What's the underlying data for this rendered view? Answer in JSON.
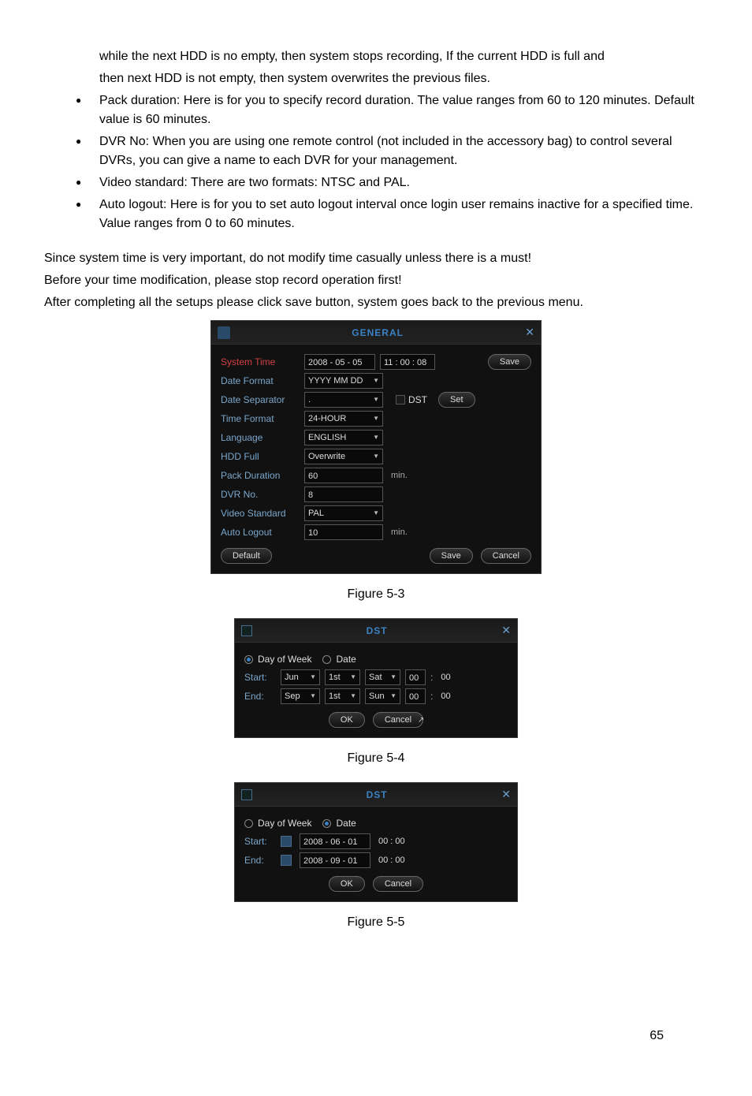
{
  "intro_lines": [
    "while the next HDD is no empty, then system stops recording, If the current HDD is full and",
    "then next HDD is not empty, then system overwrites the previous files."
  ],
  "bullets": [
    "Pack duration: Here is for you to specify record duration. The value ranges from 60 to 120 minutes. Default value is 60 minutes.",
    "DVR No: When you are using one remote control (not included in the accessory bag) to control several DVRs, you can give a name to each DVR for your management.",
    "Video standard: There are two formats: NTSC and PAL.",
    "Auto logout: Here is for you to set auto logout interval once login user remains inactive for a specified time. Value ranges from 0 to 60 minutes."
  ],
  "para1": "Since system time is very important, do not modify time casually unless there is a must!",
  "para2": "Before your time modification, please stop record operation first!",
  "para3": "After completing all the setups please click save button, system goes back to the previous menu.",
  "figure_5_3": "Figure 5-3",
  "figure_5_4": "Figure 5-4",
  "figure_5_5": "Figure 5-5",
  "page_num": "65",
  "general": {
    "title": "GENERAL",
    "system_time_label": "System Time",
    "system_date": "2008 - 05 - 05",
    "system_time": "11 : 00 : 08",
    "save_btn": "Save",
    "date_format_label": "Date Format",
    "date_format": "YYYY MM DD",
    "date_separator_label": "Date Separator",
    "date_separator": ".",
    "dst_label": "DST",
    "set_btn": "Set",
    "time_format_label": "Time Format",
    "time_format": "24-HOUR",
    "language_label": "Language",
    "language": "ENGLISH",
    "hdd_full_label": "HDD Full",
    "hdd_full": "Overwrite",
    "pack_duration_label": "Pack Duration",
    "pack_duration": "60",
    "min_unit": "min.",
    "dvr_no_label": "DVR No.",
    "dvr_no": "8",
    "video_standard_label": "Video Standard",
    "video_standard": "PAL",
    "auto_logout_label": "Auto Logout",
    "auto_logout": "10",
    "default_btn": "Default",
    "cancel_btn": "Cancel"
  },
  "dst_week": {
    "title": "DST",
    "dow": "Day of Week",
    "date": "Date",
    "start": "Start:",
    "end": "End:",
    "start_month": "Jun",
    "start_week": "1st",
    "start_day": "Sat",
    "start_hh": "00",
    "start_mm": "00",
    "end_month": "Sep",
    "end_week": "1st",
    "end_day": "Sun",
    "end_hh": "00",
    "end_mm": "00",
    "ok": "OK",
    "cancel": "Cancel"
  },
  "dst_date": {
    "title": "DST",
    "dow": "Day of Week",
    "date": "Date",
    "start": "Start:",
    "end": "End:",
    "start_date": "2008 - 06 - 01",
    "start_time": "00 : 00",
    "end_date": "2008 - 09 - 01",
    "end_time": "00 : 00",
    "ok": "OK",
    "cancel": "Cancel"
  }
}
